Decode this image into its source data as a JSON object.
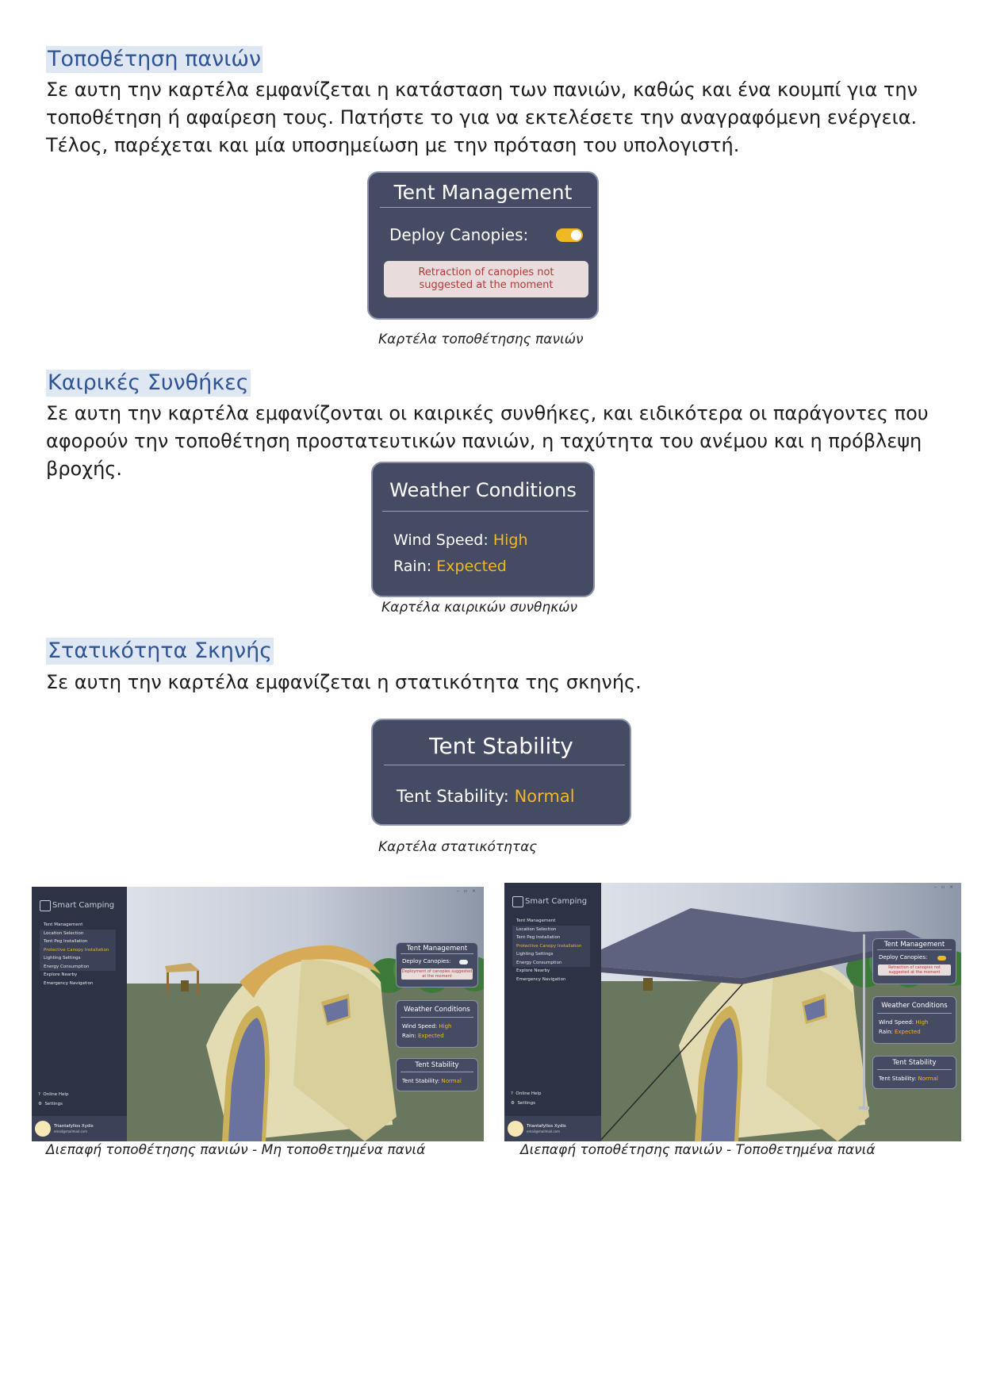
{
  "section1": {
    "heading": "Τοποθέτηση πανιών",
    "text": "Σε αυτη την καρτέλα εμφανίζεται η κατάσταση των πανιών, καθώς και ένα κουμπί για την τοποθέτηση ή αφαίρεση τους. Πατήστε το για να εκτελέσετε την αναγραφόμενη ενέργεια. Τέλος, παρέχεται και μία υποσημείωση με την πρόταση του υπολογιστή.",
    "card": {
      "title": "Tent Management",
      "label": "Deploy Canopies:",
      "suggestion": "Retraction of canopies not suggested at the moment"
    },
    "caption": "Καρτέλα τοποθέτησης πανιών"
  },
  "section2": {
    "heading": "Καιρικές Συνθήκες",
    "text": "Σε αυτη την καρτέλα εμφανίζονται οι καιρικές συνθήκες, και ειδικότερα οι παράγοντες που αφορούν την τοποθέτηση προστατευτικών πανιών, η ταχύτητα του ανέμου και η πρόβλεψη βροχής.",
    "card": {
      "title": "Weather Conditions",
      "wind_label": "Wind Speed:",
      "wind_value": "High",
      "rain_label": "Rain:",
      "rain_value": "Expected"
    },
    "caption": "Καρτέλα καιρικών συνθηκών"
  },
  "section3": {
    "heading": "Στατικότητα Σκηνής",
    "text": "Σε αυτη την καρτέλα εμφανίζεται η στατικότητα της σκηνής.",
    "card": {
      "title": "Tent Stability",
      "label": "Tent Stability:",
      "value": "Normal"
    },
    "caption": "Καρτέλα στατικότητας"
  },
  "screens": {
    "app_name": "Smart Camping",
    "menu": [
      "Tent Management",
      "Location Selection",
      "Tent Peg Installation",
      "Protective Canopy Installation",
      "Lighting Settings",
      "Energy Consumption",
      "Explore Nearby",
      "Emergency Navigation"
    ],
    "online_help": "Online Help",
    "settings": "Settings",
    "user_name": "Triantafyllos Xydis",
    "user_email": "email@mailmail.com",
    "tent_title": "Tent Management",
    "deploy_label": "Deploy Canopies:",
    "left_suggestion": "Deployment of canopies suggested at the moment",
    "right_suggestion": "Retraction of canopies not suggested at the moment",
    "weather_title": "Weather Conditions",
    "wind_label": "Wind Speed:",
    "wind_value": "High",
    "rain_label": "Rain:",
    "rain_value": "Expected",
    "stability_title": "Tent Stability",
    "stability_label": "Tent Stability:",
    "stability_value": "Normal",
    "left_caption": "Διεπαφή τοποθέτησης πανιών - Μη τοποθετημένα πανιά",
    "right_caption": "Διεπαφή τοποθέτησης πανιών - Τοποθετημένα πανιά"
  },
  "colors": {
    "heading": "#2f5496",
    "card_bg": "#454b63",
    "accent": "#f0b824",
    "suggest_text": "#b03a3a"
  }
}
